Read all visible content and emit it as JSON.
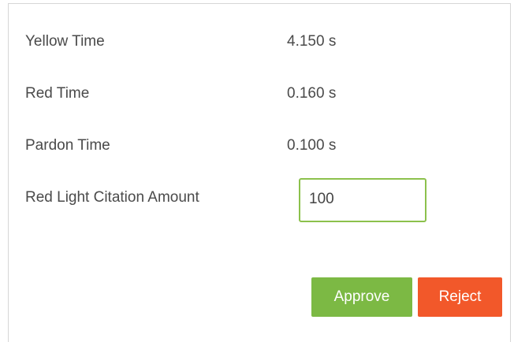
{
  "fields": [
    {
      "label": "Yellow Time",
      "value": "4.150 s"
    },
    {
      "label": "Red Time",
      "value": "0.160 s"
    },
    {
      "label": "Pardon Time",
      "value": "0.100 s"
    }
  ],
  "citation": {
    "label": "Red Light Citation Amount",
    "value": "100"
  },
  "actions": {
    "approve_label": "Approve",
    "reject_label": "Reject"
  },
  "colors": {
    "approve": "#7cb944",
    "reject": "#f2582a",
    "input_border": "#8cc14c"
  }
}
